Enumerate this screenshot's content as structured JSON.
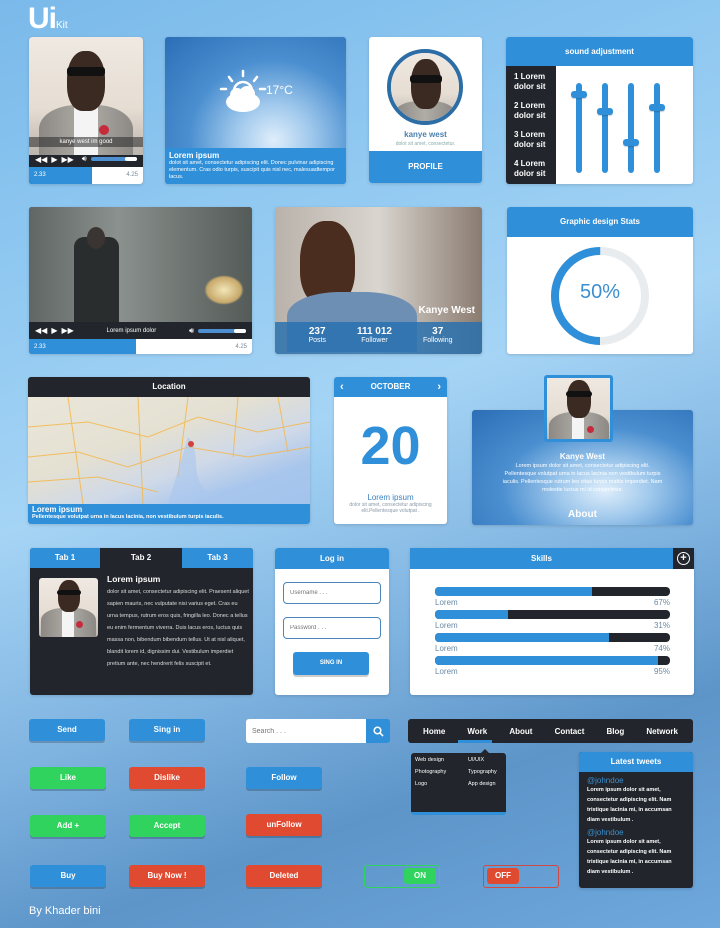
{
  "logo": {
    "main": "Ui",
    "sub": "Kit"
  },
  "player1": {
    "caption": "kanye west im good",
    "time_elapsed": "2.33",
    "time_total": "4.25",
    "progress_percent": 55,
    "volume_percent": 85
  },
  "weather": {
    "temperature": "17°C",
    "icon": "partly-cloudy-icon",
    "title": "Lorem ipsum",
    "text": "dolot sit amet, consectetur adipiscing elit. Donec pulvinar adipiscing elementum. Cras odio turpis, suscipit quis nisl nec, malesuadtempor lacus."
  },
  "profile": {
    "name": "kanye west",
    "subtitle": "dolot sit amet, consectetur.",
    "button": "PROFILE"
  },
  "sound": {
    "title": "sound adjustment",
    "labels": [
      "1 Lorem dolor sit",
      "2 Lorem dolor sit",
      "3 Lorem dolor sit",
      "4 Lorem dolor sit"
    ],
    "levels_percent": [
      90,
      70,
      33,
      75
    ]
  },
  "player2": {
    "caption": "Lorem ipsum dolor",
    "time_elapsed": "2.33",
    "time_total": "4.25",
    "progress_percent": 48,
    "volume_percent": 85
  },
  "social": {
    "name": "Kanye West",
    "stats": [
      {
        "value": "237",
        "label": "Posts"
      },
      {
        "value": "111 012",
        "label": "Follower"
      },
      {
        "value": "37",
        "label": "Following"
      }
    ]
  },
  "stats": {
    "title": "Graphic design Stats",
    "value": "50%",
    "percent": 50
  },
  "location": {
    "title": "Location",
    "caption_title": "Lorem ipsum",
    "caption_text": "Pellentesque volutpat urna in lacus lacinia, non vestibulum turpis iaculis."
  },
  "calendar": {
    "month": "OCTOBER",
    "day": "20",
    "title": "Lorem ipsum",
    "text": "dolor sit amet, consectetur adipiscing elit.Pellentesque volutpat ."
  },
  "about": {
    "name": "Kanye West",
    "text": "Lorem ipsum dolor sit amet, consectetur adipiscing elit. Pellentesque volutpat urna in lacus lacinia non vestibulum turpis iaculis. Pellentesque rutrum leo vitae turpis mattis imperdiet. Nam molestie luctus mi id consectetur.",
    "button": "About"
  },
  "tabs": {
    "items": [
      "Tab 1",
      "Tab 2",
      "Tab 3"
    ],
    "active": 1,
    "title": "Lorem ipsum",
    "text": "dolor sit amet, consectetur adipiscing elit. Praesent aliquet sapien mauris, nec vulputate nisi varius eget. Cras eu urna tempus, rutrum eros quis, fringilla leo. Donec a tellus eu enim fermentum viverra. Duis lacus eros, luctus quis massa non, bibendum bibendum tellus. Ut at nisl aliquet, blandit lorem id, dignissim dui. Vestibulum imperdiet pretium ante, nec hendrerit felis suscipit et."
  },
  "login": {
    "title": "Log in",
    "username_placeholder": "Username . . .",
    "password_placeholder": "Password . . .",
    "button": "SING IN"
  },
  "skills": {
    "title": "Skills",
    "items": [
      {
        "label": "Lorem",
        "value": "67%",
        "percent": 67
      },
      {
        "label": "Lorem",
        "value": "31%",
        "percent": 31
      },
      {
        "label": "Lorem",
        "value": "74%",
        "percent": 74
      },
      {
        "label": "Lorem",
        "value": "95%",
        "percent": 95
      }
    ]
  },
  "buttons": {
    "send": "Send",
    "signin": "Sing in",
    "like": "Like",
    "dislike": "Dislike",
    "follow": "Follow",
    "add": "Add +",
    "accept": "Accept",
    "unfollow": "unFollow",
    "buy": "Buy",
    "buynow": "Buy Now !",
    "deleted": "Deleted"
  },
  "search": {
    "placeholder": "Search . . ."
  },
  "nav": {
    "items": [
      "Home",
      "Work",
      "About",
      "Contact",
      "Blog",
      "Network"
    ],
    "active": "Work",
    "dropdown": [
      [
        "Web design",
        "UI/UIX"
      ],
      [
        "Photography",
        "Typography"
      ],
      [
        "Logo",
        "App design"
      ]
    ]
  },
  "toggles": {
    "on": "ON",
    "off": "OFF"
  },
  "tweets": {
    "title": "Latest tweets",
    "items": [
      {
        "handle": "@johndoe",
        "text": "Lorem ipsum dolor sit amet, consectetur adipiscing elit. Nam tristique lacinia mi, in accumsan diam vestibulum ."
      },
      {
        "handle": "@johndoe",
        "text": "Lorem ipsum dolor sit amet, consectetur adipiscing elit. Nam tristique lacinia mi, in accumsan diam vestibulum ."
      }
    ]
  },
  "footer": {
    "credit": "By Khader bini"
  },
  "colors": {
    "accent": "#2f8fd8",
    "dark": "#22252b",
    "green": "#2fd35d",
    "red": "#e04a30"
  }
}
